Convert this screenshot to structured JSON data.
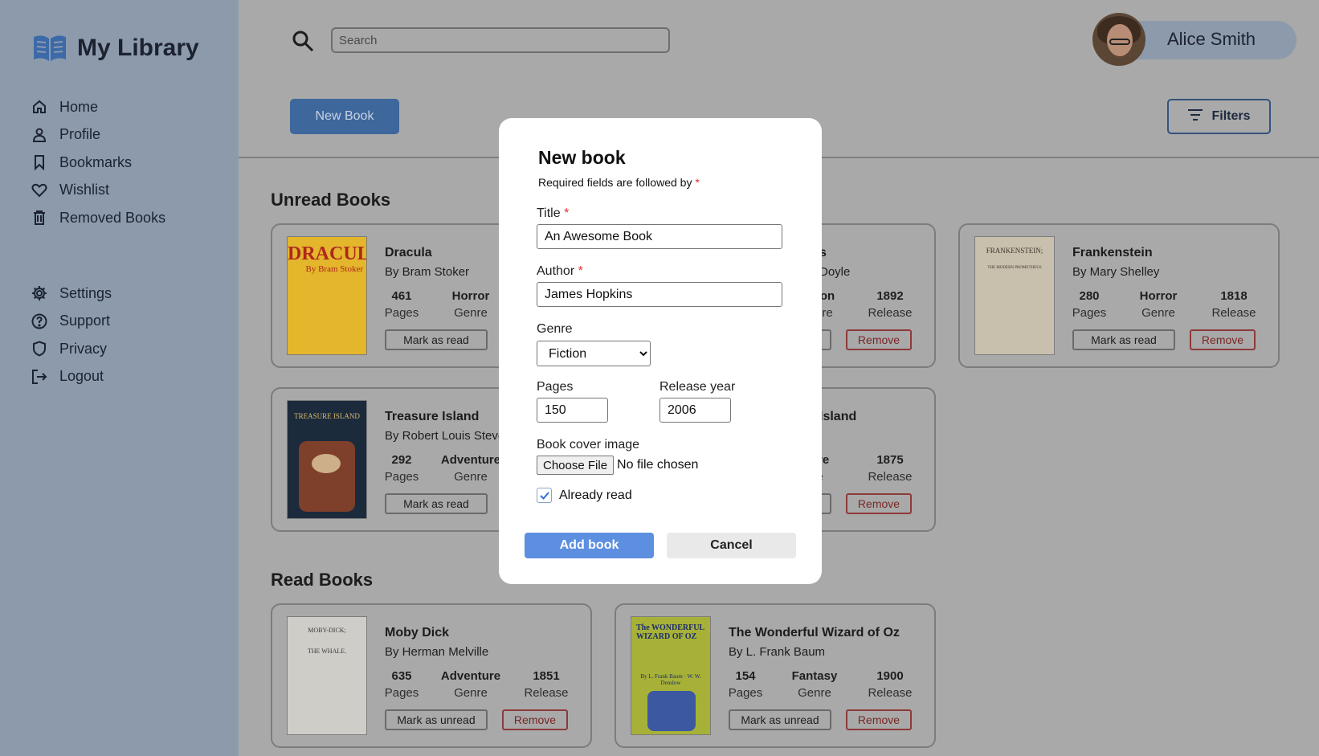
{
  "app": {
    "title": "My Library",
    "logo_icon": "open-book-icon",
    "accent_color": "#3e679c"
  },
  "sidebar": {
    "primary": [
      {
        "label": "Home",
        "icon": "home-icon"
      },
      {
        "label": "Profile",
        "icon": "user-icon"
      },
      {
        "label": "Bookmarks",
        "icon": "bookmark-icon"
      },
      {
        "label": "Wishlist",
        "icon": "heart-icon"
      },
      {
        "label": "Removed Books",
        "icon": "trash-icon"
      }
    ],
    "secondary": [
      {
        "label": "Settings",
        "icon": "gear-icon"
      },
      {
        "label": "Support",
        "icon": "help-icon"
      },
      {
        "label": "Privacy",
        "icon": "shield-icon"
      },
      {
        "label": "Logout",
        "icon": "logout-icon"
      }
    ]
  },
  "header": {
    "search_placeholder": "Search",
    "user_name": "Alice Smith"
  },
  "toolbar": {
    "new_book_label": "New Book",
    "filters_label": "Filters"
  },
  "sections": {
    "unread_title": "Unread Books",
    "read_title": "Read Books"
  },
  "labels": {
    "pages": "Pages",
    "genre": "Genre",
    "release": "Release",
    "mark_read": "Mark as read",
    "mark_unread": "Mark as unread",
    "remove": "Remove"
  },
  "unread_books": [
    {
      "title": "Dracula",
      "author": "By Bram Stoker",
      "pages": "461",
      "genre": "Horror",
      "release": "",
      "cover_text": "DRACULA",
      "cover_sub": "By Bram Stoker"
    },
    {
      "title": "s",
      "author": "Doyle",
      "pages": "",
      "genre": "on",
      "release": "1892",
      "cover_text": "",
      "cover_sub": ""
    },
    {
      "title": "Frankenstein",
      "author": "By Mary Shelley",
      "pages": "280",
      "genre": "Horror",
      "release": "1818",
      "cover_text": "FRANKENSTEIN;",
      "cover_sub": "THE MODERN PROMETHEUS"
    },
    {
      "title": "Treasure Island",
      "author": "By Robert Louis Steve",
      "pages": "292",
      "genre": "Adventure",
      "release": "",
      "cover_text": "TREASURE ISLAND",
      "cover_sub": ""
    },
    {
      "title": "Island",
      "author": "",
      "pages": "",
      "genre": "ture",
      "release": "1875",
      "cover_text": "",
      "cover_sub": ""
    }
  ],
  "read_books": [
    {
      "title": "Moby Dick",
      "author": "By Herman Melville",
      "pages": "635",
      "genre": "Adventure",
      "release": "1851",
      "cover_text": "MOBY-DICK;",
      "cover_sub": "THE WHALE."
    },
    {
      "title": "The Wonderful Wizard of Oz",
      "author": "By L. Frank Baum",
      "pages": "154",
      "genre": "Fantasy",
      "release": "1900",
      "cover_text": "The WONDERFUL WIZARD OF OZ",
      "cover_sub": "By L. Frank Baum · W. W. Denslow"
    }
  ],
  "modal": {
    "title": "New book",
    "required_note": "Required fields are followed by",
    "required_marker": "*",
    "title_label": "Title",
    "title_value": "An Awesome Book",
    "author_label": "Author",
    "author_value": "James Hopkins",
    "genre_label": "Genre",
    "genre_value": "Fiction",
    "pages_label": "Pages",
    "pages_value": "150",
    "release_label": "Release year",
    "release_value": "2006",
    "cover_label": "Book cover image",
    "choose_file_label": "Choose File",
    "no_file_text": "No file chosen",
    "already_read_label": "Already read",
    "already_read_checked": true,
    "add_label": "Add book",
    "cancel_label": "Cancel"
  }
}
